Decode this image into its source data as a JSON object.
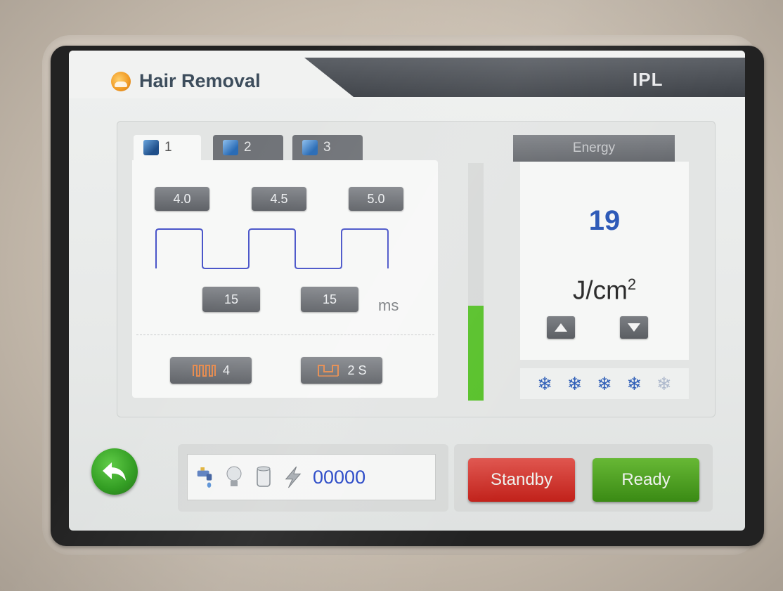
{
  "header": {
    "title": "Hair Removal",
    "mode": "IPL",
    "logo_icon": "sun-logo-icon"
  },
  "tabs": [
    {
      "label": "1",
      "active": true,
      "icon": "book-icon"
    },
    {
      "label": "2",
      "active": false,
      "icon": "book-icon"
    },
    {
      "label": "3",
      "active": false,
      "icon": "book-icon"
    }
  ],
  "pulse": {
    "widths": [
      "4.0",
      "4.5",
      "5.0"
    ],
    "delays": [
      "15",
      "15"
    ],
    "delay_unit": "ms",
    "pulse_count": "4",
    "pulse_count_icon": "pulse-train-icon",
    "interval": "2 S",
    "interval_icon": "interval-icon"
  },
  "energy_bar": {
    "level": 0.4,
    "color": "#58c12a"
  },
  "energy": {
    "header": "Energy",
    "value": "19",
    "unit_base": "J/cm",
    "unit_exp": "2",
    "up_icon": "arrow-up-icon",
    "down_icon": "arrow-down-icon"
  },
  "cooling": {
    "levels_total": 5,
    "levels_active": 4,
    "icon": "snowflake-icon"
  },
  "status": {
    "icons": [
      "water-tap-icon",
      "lamp-bulb-icon",
      "cylinder-icon",
      "lightning-icon"
    ],
    "counter": "00000"
  },
  "buttons": {
    "back_icon": "back-arrow-icon",
    "standby": "Standby",
    "ready": "Ready"
  },
  "colors": {
    "accent_blue": "#2b58b7",
    "standby_red": "#c1211a",
    "ready_green": "#3a8a14",
    "header_dark": "#3e4248"
  }
}
